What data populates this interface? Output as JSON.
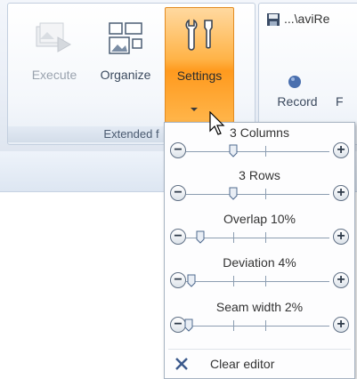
{
  "ribbon": {
    "buttons": {
      "execute": "Execute",
      "organize": "Organize",
      "settings": "Settings",
      "record": "Record"
    },
    "group_label": "Extended f",
    "title_partial": "...\\aviRe"
  },
  "settings_menu": {
    "items": [
      {
        "label": "3 Columns",
        "value": 0.33
      },
      {
        "label": "3 Rows",
        "value": 0.33
      },
      {
        "label": "Overlap 10%",
        "value": 0.1
      },
      {
        "label": "Deviation 4%",
        "value": 0.04
      },
      {
        "label": "Seam width 2%",
        "value": 0.02
      }
    ],
    "clear_label": "Clear editor"
  },
  "colors": {
    "accent_orange": "#ffb347",
    "ribbon_blue": "#dde6f2"
  }
}
